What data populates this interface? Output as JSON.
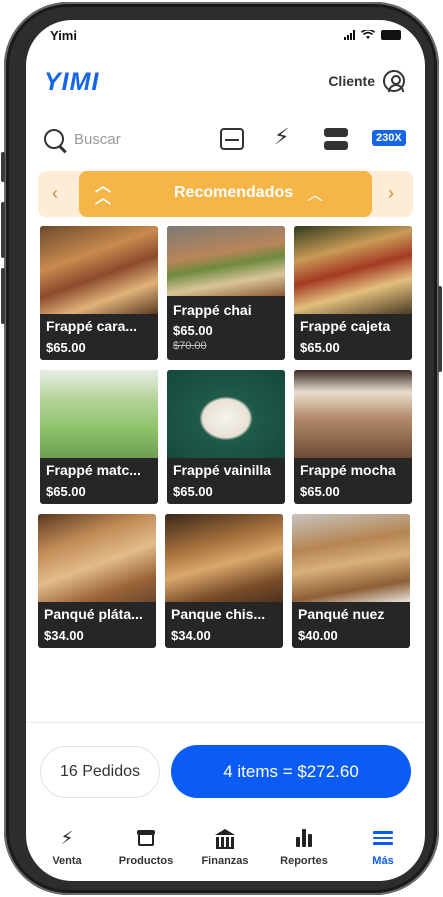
{
  "status": {
    "carrier": "Yimi"
  },
  "header": {
    "logo": "YIMI",
    "user_label": "Cliente"
  },
  "search": {
    "placeholder": "Buscar"
  },
  "toolbar": {
    "badge": "230X"
  },
  "category": {
    "label": "Recomendados"
  },
  "products": [
    {
      "name": "Frappé cara...",
      "price": "$65.00"
    },
    {
      "name": "Frappé chai",
      "price": "$65.00",
      "old_price": "$70.00"
    },
    {
      "name": "Frappé cajeta",
      "price": "$65.00"
    },
    {
      "name": "Frappé matc...",
      "price": "$65.00"
    },
    {
      "name": "Frappé vainilla",
      "price": "$65.00"
    },
    {
      "name": "Frappé mocha",
      "price": "$65.00"
    },
    {
      "name": "Panqué pláta...",
      "price": "$34.00"
    },
    {
      "name": "Panque chis...",
      "price": "$34.00"
    },
    {
      "name": "Panqué nuez",
      "price": "$40.00"
    }
  ],
  "actions": {
    "orders": "16 Pedidos",
    "total": "4 items = $272.60"
  },
  "tabs": [
    {
      "label": "Venta",
      "icon": "bolt-icon"
    },
    {
      "label": "Productos",
      "icon": "box-icon"
    },
    {
      "label": "Finanzas",
      "icon": "bank-icon"
    },
    {
      "label": "Reportes",
      "icon": "chart-icon"
    },
    {
      "label": "Más",
      "icon": "menu-icon",
      "active": true
    }
  ],
  "colors": {
    "brand": "#1565e6",
    "primary_button": "#0a5cf5",
    "category_active": "#f5b547",
    "category_bg": "#fdedd6"
  }
}
